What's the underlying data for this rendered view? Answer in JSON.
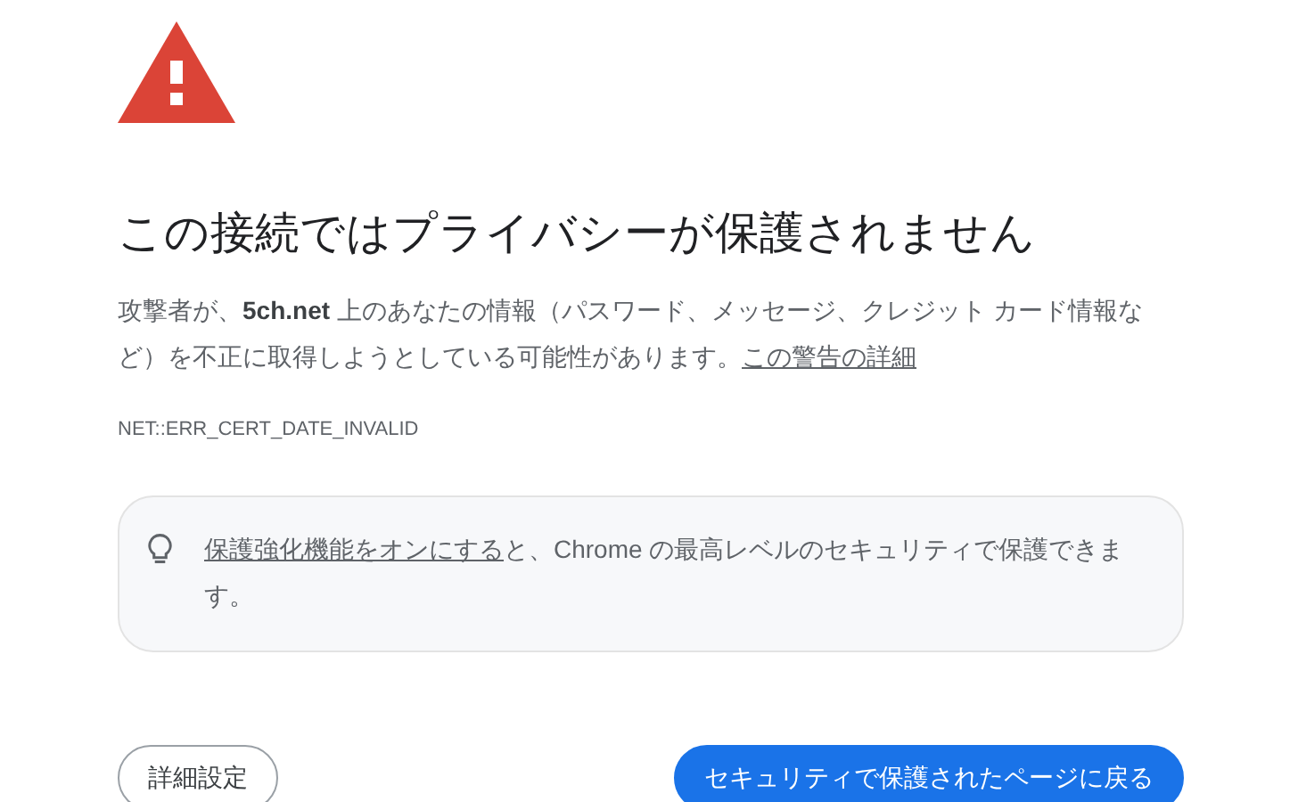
{
  "title": "この接続ではプライバシーが保護されません",
  "description": {
    "text": "攻撃者が、**5ch.net** 上のあなたの情報（パスワード、メッセージ、クレジット カード情報など）を不正に取得しようとしている可能性があります。",
    "link": "この警告の詳細"
  },
  "error_code": "NET::ERR_CERT_DATE_INVALID",
  "tip": {
    "link": "保護強化機能をオンにする",
    "text": "と、Chrome の最高レベルのセキュリティで保護できます。"
  },
  "buttons": [
    {
      "label": "詳細設定",
      "kind": "secondary"
    },
    {
      "label": "セキュリティで保護されたページに戻る",
      "kind": "primary"
    }
  ]
}
